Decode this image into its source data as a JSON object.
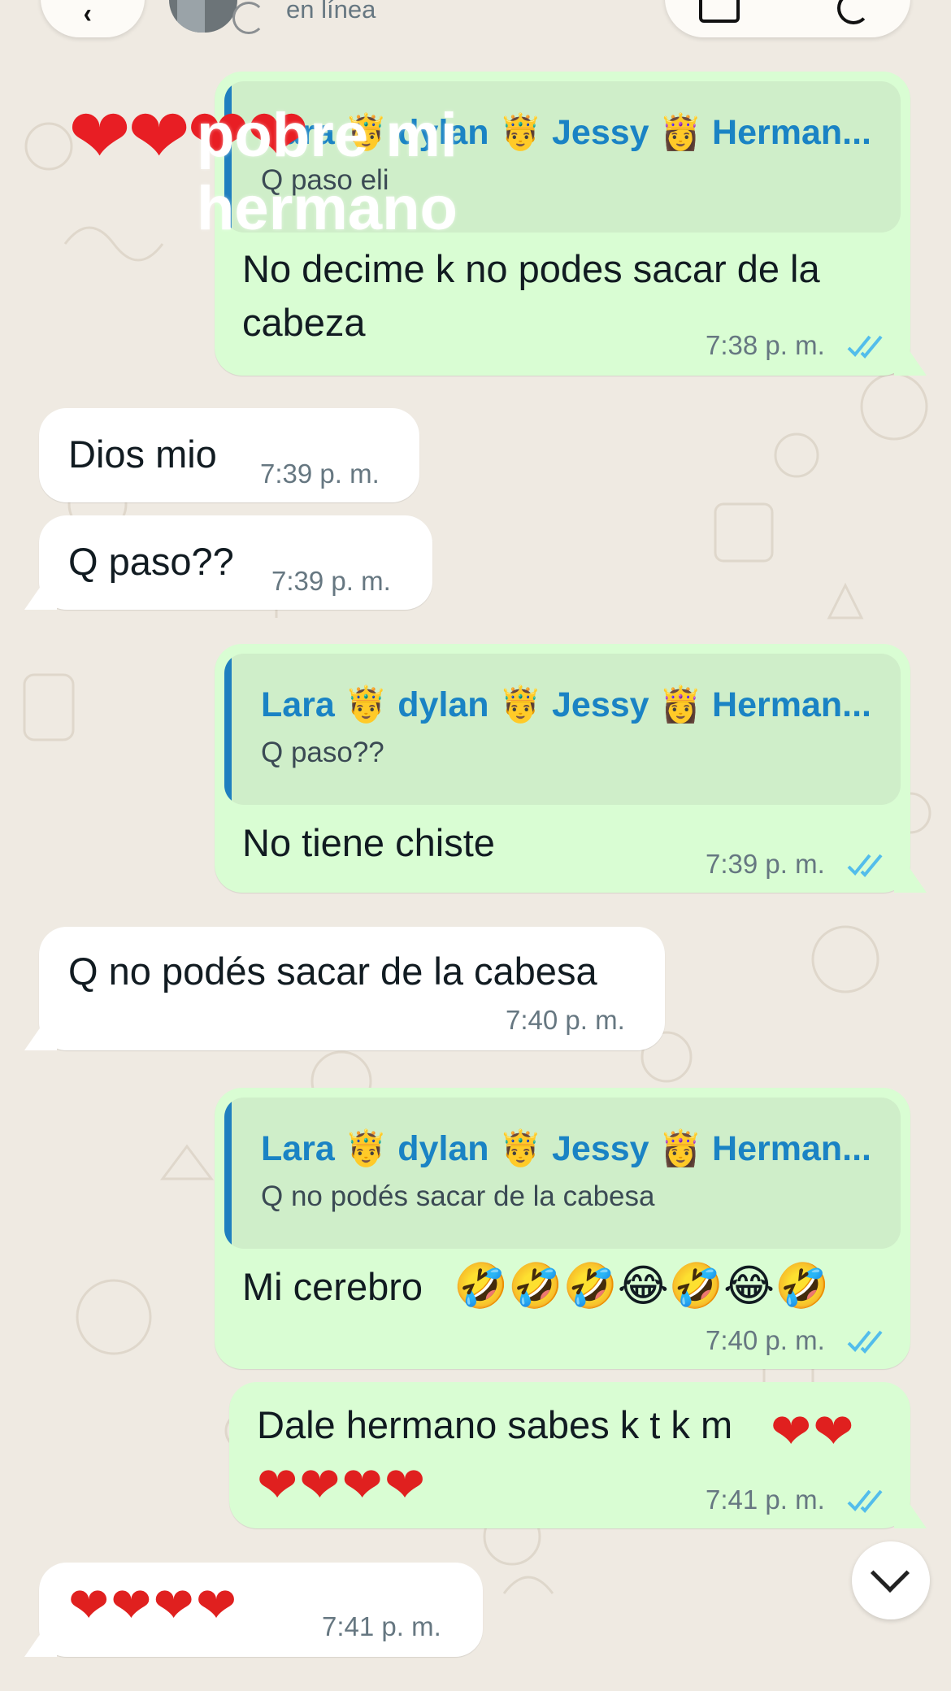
{
  "header": {
    "contact_status": "en línea"
  },
  "overlay": {
    "hearts": "❤❤❤❤",
    "title": "pobre mi hermano"
  },
  "messages": [
    {
      "quote_author": "Lara 🤴 dylan 🤴 Jessy 👸 Herman...",
      "quote_text": "Q paso eli",
      "text": "No decime k no podes sacar de la cabeza",
      "time": "7:38 p. m."
    },
    {
      "text": "Dios mio",
      "time": "7:39 p. m."
    },
    {
      "text": "Q paso??",
      "time": "7:39 p. m."
    },
    {
      "quote_author": "Lara 🤴 dylan 🤴 Jessy 👸 Herman...",
      "quote_text": "Q paso??",
      "text": "No tiene chiste",
      "time": "7:39 p. m."
    },
    {
      "text": "Q no podés sacar de la cabesa",
      "time": "7:40 p. m."
    },
    {
      "quote_author": "Lara 🤴 dylan 🤴 Jessy 👸 Herman...",
      "quote_text": "Q no podés sacar de la cabesa",
      "text": "Mi cerebro",
      "emojis": "🤣🤣🤣😂🤣😂🤣",
      "time": "7:40 p. m."
    },
    {
      "text": "Dale hermano sabes k t k m",
      "hearts_inline": "❤❤",
      "hearts_line2": "❤❤❤❤",
      "time": "7:41 p. m."
    },
    {
      "hearts": "❤❤❤❤",
      "time": "7:41 p. m."
    }
  ],
  "colors": {
    "outgoing_bubble": "#d9fdd3",
    "incoming_bubble": "#ffffff",
    "quote_author": "#1a83c4",
    "read_ticks": "#53bdeb",
    "background": "#efeae2"
  },
  "icons": [
    "back-icon",
    "video-call-icon",
    "phone-call-icon",
    "double-check-icon",
    "chevron-down-icon"
  ]
}
